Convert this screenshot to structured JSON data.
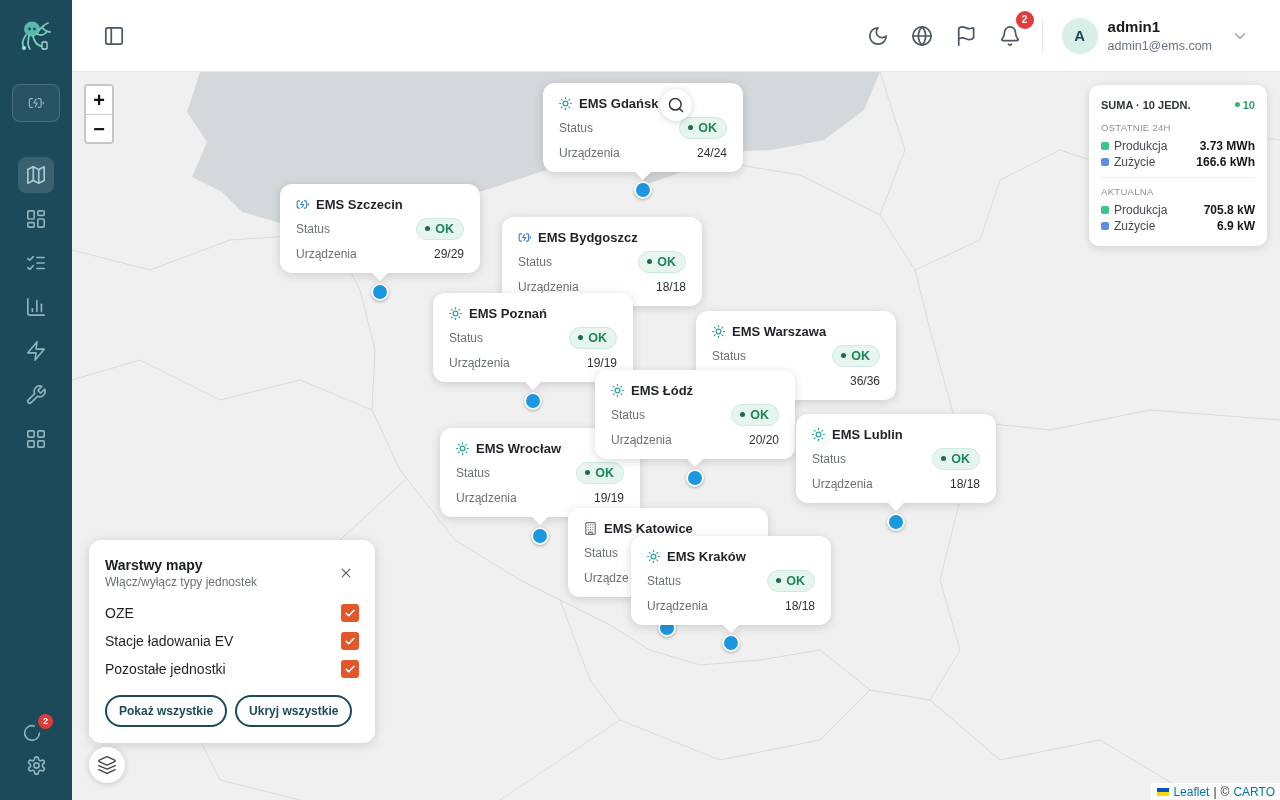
{
  "sidebar": {
    "items": [
      {
        "kind": "ev",
        "selected": false
      },
      {
        "kind": "map",
        "selected": true
      },
      {
        "kind": "dashboard",
        "selected": false
      },
      {
        "kind": "tasks",
        "selected": false
      },
      {
        "kind": "chart",
        "selected": false
      },
      {
        "kind": "energy",
        "selected": false
      },
      {
        "kind": "tools",
        "selected": false
      },
      {
        "kind": "apps",
        "selected": false
      }
    ],
    "alerts_badge": "2"
  },
  "header": {
    "notifications_badge": "2",
    "user": {
      "initial": "A",
      "name": "admin1",
      "email": "admin1@ems.com"
    }
  },
  "map": {
    "zoom_in": "+",
    "zoom_out": "−",
    "units": [
      {
        "kind": "solar",
        "name": "EMS Gdańsk",
        "status_label": "Status",
        "status": "OK",
        "devices_label": "Urządzenia",
        "devices": "24/24"
      },
      {
        "kind": "ev",
        "name": "EMS Szczecin",
        "status_label": "Status",
        "status": "OK",
        "devices_label": "Urządzenia",
        "devices": "29/29"
      },
      {
        "kind": "ev",
        "name": "EMS Bydgoszcz",
        "status_label": "Status",
        "status": "OK",
        "devices_label": "Urządzenia",
        "devices": "18/18"
      },
      {
        "kind": "solar",
        "name": "EMS Poznań",
        "status_label": "Status",
        "status": "OK",
        "devices_label": "Urządzenia",
        "devices": "19/19"
      },
      {
        "kind": "solar",
        "name": "EMS Warszawa",
        "status_label": "Status",
        "status": "OK",
        "devices": "36/36"
      },
      {
        "kind": "solar",
        "name": "EMS Łódź",
        "status_label": "Status",
        "status": "OK",
        "devices_label": "Urządzenia",
        "devices": "20/20"
      },
      {
        "kind": "solar",
        "name": "EMS Lublin",
        "status_label": "Status",
        "status": "OK",
        "devices_label": "Urządzenia",
        "devices": "18/18"
      },
      {
        "kind": "solar",
        "name": "EMS Wrocław",
        "status_label": "Status",
        "status": "OK",
        "devices_label": "Urządzenia",
        "devices": "19/19"
      },
      {
        "kind": "building",
        "name": "EMS Katowice",
        "status_label": "Status",
        "devices_label": "Urządze"
      },
      {
        "kind": "solar",
        "name": "EMS Kraków",
        "status_label": "Status",
        "status": "OK",
        "devices_label": "Urządzenia",
        "devices": "18/18"
      }
    ],
    "summary": {
      "title": "SUMA · 10 JEDN.",
      "online_count": "10",
      "sections": [
        {
          "label": "OSTATNIE 24H",
          "rows": [
            {
              "label": "Produkcja",
              "value": "3.73 MWh",
              "color": "#3cc48f"
            },
            {
              "label": "Zużycie",
              "value": "166.6 kWh",
              "color": "#5b8fe6"
            }
          ]
        },
        {
          "label": "AKTUALNA",
          "rows": [
            {
              "label": "Produkcja",
              "value": "705.8 kW",
              "color": "#3cc48f"
            },
            {
              "label": "Zużycie",
              "value": "6.9 kW",
              "color": "#5b8fe6"
            }
          ]
        }
      ]
    },
    "layers": {
      "title": "Warstwy mapy",
      "subtitle": "Włącz/wyłącz typy jednostek",
      "options": [
        {
          "label": "OZE",
          "checked": true
        },
        {
          "label": "Stacje ładowania EV",
          "checked": true
        },
        {
          "label": "Pozostałe jednostki",
          "checked": true
        }
      ],
      "buttons": [
        "Pokaż wszystkie",
        "Ukryj wszystkie"
      ]
    },
    "attribution": {
      "link": "Leaflet",
      "separator": "|",
      "copyright": "©",
      "provider": "CARTO"
    }
  }
}
